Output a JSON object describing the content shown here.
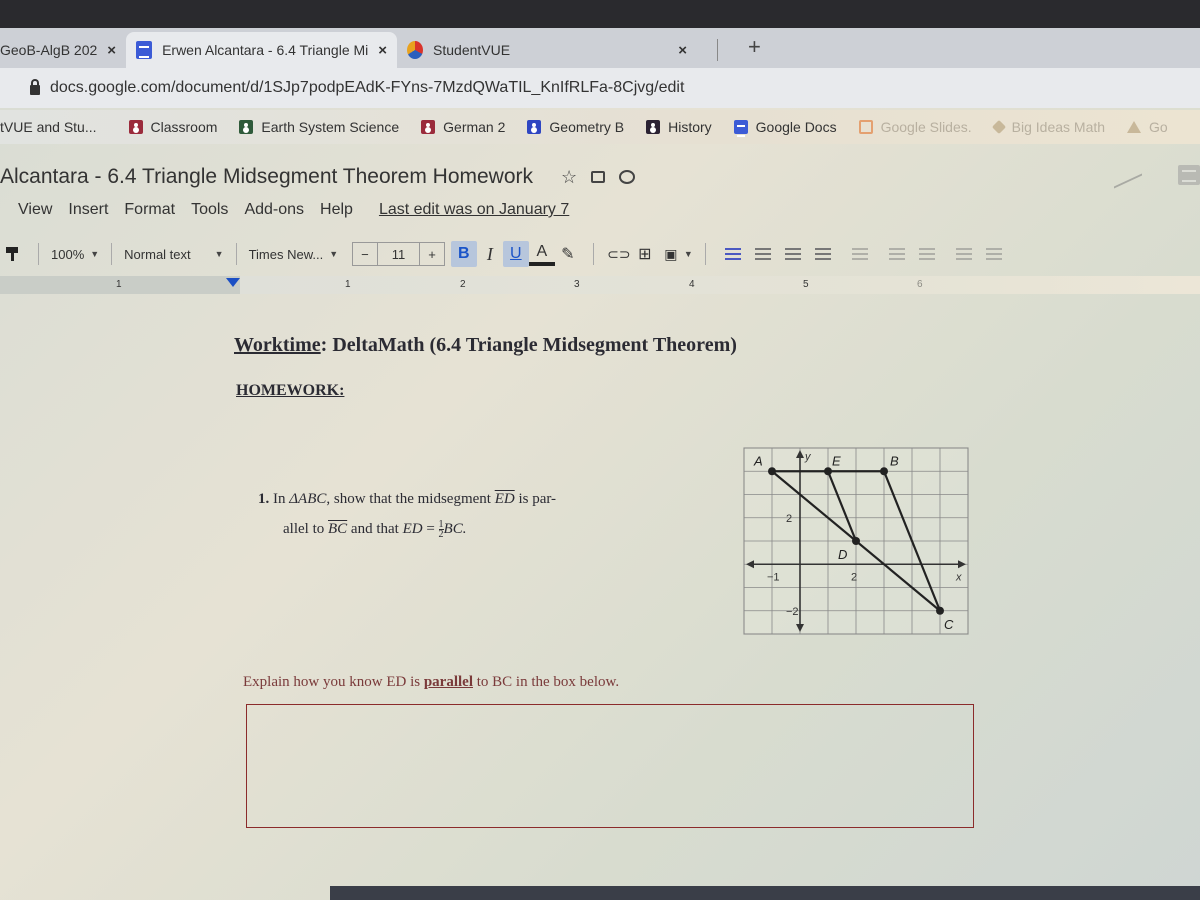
{
  "browser": {
    "tabs": [
      {
        "label": "GeoB-AlgB 202",
        "icon": "classroom-icon",
        "active": false
      },
      {
        "label": "Erwen Alcantara - 6.4 Triangle Mi",
        "icon": "google-docs-icon",
        "active": true
      },
      {
        "label": "StudentVUE",
        "icon": "studentvue-icon",
        "active": false
      }
    ],
    "close_glyph": "×",
    "new_tab_glyph": "+",
    "url": "docs.google.com/document/d/1SJp7podpEAdK-FYns-7MzdQWaTIL_KnIfRLFa-8Cjvg/edit",
    "bookmarks": [
      {
        "label": "tVUE and Stu...",
        "icon": "none",
        "color": ""
      },
      {
        "label": "Classroom",
        "icon": "classroom-icon",
        "color": "#9b2b3c"
      },
      {
        "label": "Earth System Science",
        "icon": "classroom-icon",
        "color": "#2f5a3a"
      },
      {
        "label": "German 2",
        "icon": "classroom-icon",
        "color": "#9b2b3c"
      },
      {
        "label": "Geometry B",
        "icon": "classroom-icon",
        "color": "#2f46c2"
      },
      {
        "label": "History",
        "icon": "classroom-icon",
        "color": "#2b2233"
      },
      {
        "label": "Google Docs",
        "icon": "google-docs-icon",
        "color": "#3c5bd6"
      },
      {
        "label": "Google Slides.",
        "icon": "google-slides-icon",
        "color": "#e4a070"
      },
      {
        "label": "Big Ideas Math",
        "icon": "big-ideas-icon",
        "color": "#c8b89a"
      },
      {
        "label": "Go",
        "icon": "drive-icon",
        "color": "#c8b89a"
      }
    ]
  },
  "doc": {
    "title": "Alcantara - 6.4 Triangle Midsegment Theorem Homework",
    "star_glyph": "☆",
    "menu": [
      "View",
      "Insert",
      "Format",
      "Tools",
      "Add-ons",
      "Help"
    ],
    "last_edit": "Last edit was on January 7"
  },
  "toolbar": {
    "zoom": "100%",
    "style": "Normal text",
    "font": "Times New...",
    "font_size": "11",
    "minus": "−",
    "plus": "+",
    "bold": "B",
    "italic": "I",
    "underline": "U",
    "text_color": "A"
  },
  "ruler": {
    "labels": [
      "1",
      "1",
      "2",
      "3",
      "4",
      "5",
      "6"
    ]
  },
  "content": {
    "worktime_label": "Worktime",
    "worktime_rest": ": DeltaMath (6.4 Triangle Midsegment Theorem)",
    "homework": "HOMEWORK:",
    "problem_number": "1.",
    "problem_in": "In ",
    "triangle": "ΔABC",
    "problem_mid": ", show that the midsegment ",
    "seg_ed": "ED",
    "problem_par": " is par-",
    "problem_allel": "allel to ",
    "seg_bc": "BC",
    "problem_and": " and that ",
    "ed_eq": "ED",
    "eq": " = ",
    "frac_num": "1",
    "frac_den": "2",
    "bc_end": "BC.",
    "prompt_start": "Explain how you know ED is ",
    "prompt_key": "parallel",
    "prompt_end": " to BC in the box below.",
    "answer_value": ""
  },
  "chart_data": {
    "type": "scatter",
    "title": "",
    "xlabel": "x",
    "ylabel": "y",
    "xlim": [
      -2,
      6
    ],
    "ylim": [
      -3,
      5
    ],
    "grid": true,
    "x_tick_labels": [
      {
        "value": -1,
        "label": "−1"
      },
      {
        "value": 2,
        "label": "2"
      }
    ],
    "y_tick_labels": [
      {
        "value": 2,
        "label": "2"
      },
      {
        "value": -2,
        "label": "−2"
      }
    ],
    "points": [
      {
        "name": "A",
        "x": -1,
        "y": 4
      },
      {
        "name": "E",
        "x": 1,
        "y": 4
      },
      {
        "name": "B",
        "x": 3,
        "y": 4
      },
      {
        "name": "D",
        "x": 2,
        "y": 1
      },
      {
        "name": "C",
        "x": 5,
        "y": -2
      }
    ],
    "segments": [
      [
        "A",
        "B"
      ],
      [
        "B",
        "C"
      ],
      [
        "A",
        "C"
      ],
      [
        "E",
        "D"
      ]
    ]
  }
}
